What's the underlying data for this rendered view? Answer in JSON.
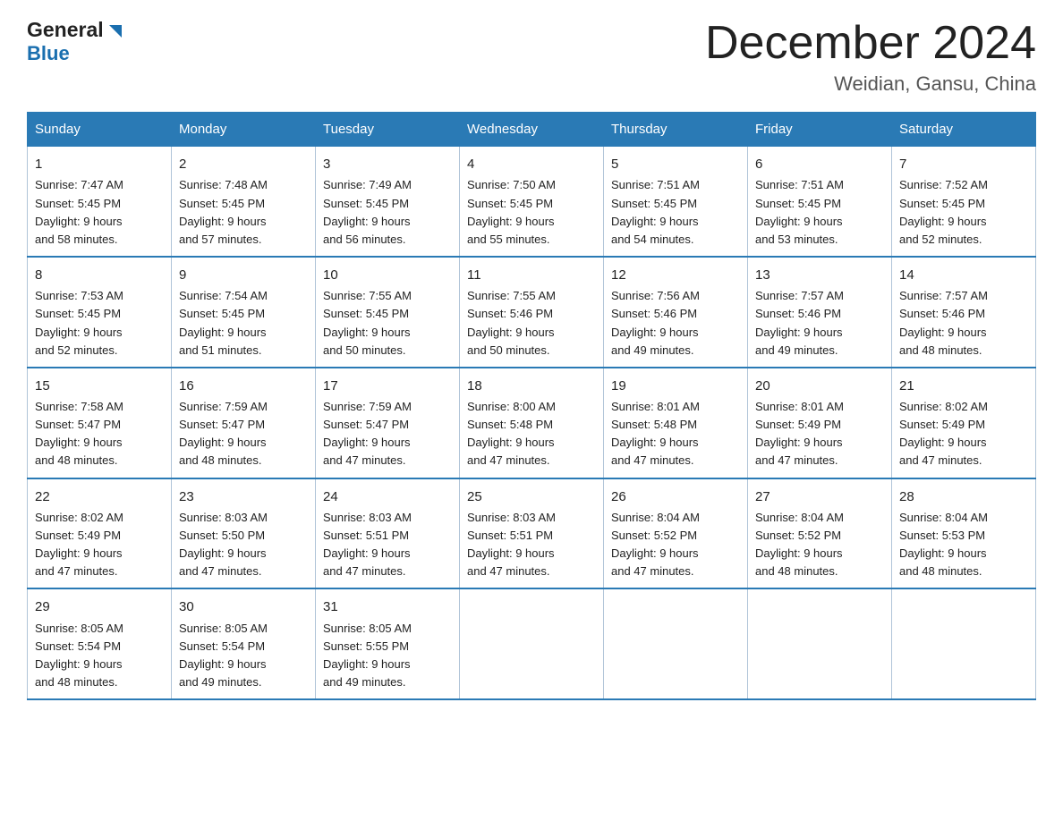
{
  "header": {
    "logo_general": "General",
    "logo_blue": "Blue",
    "title": "December 2024",
    "subtitle": "Weidian, Gansu, China"
  },
  "days_of_week": [
    "Sunday",
    "Monday",
    "Tuesday",
    "Wednesday",
    "Thursday",
    "Friday",
    "Saturday"
  ],
  "weeks": [
    [
      {
        "day": "1",
        "sunrise": "7:47 AM",
        "sunset": "5:45 PM",
        "daylight": "9 hours and 58 minutes."
      },
      {
        "day": "2",
        "sunrise": "7:48 AM",
        "sunset": "5:45 PM",
        "daylight": "9 hours and 57 minutes."
      },
      {
        "day": "3",
        "sunrise": "7:49 AM",
        "sunset": "5:45 PM",
        "daylight": "9 hours and 56 minutes."
      },
      {
        "day": "4",
        "sunrise": "7:50 AM",
        "sunset": "5:45 PM",
        "daylight": "9 hours and 55 minutes."
      },
      {
        "day": "5",
        "sunrise": "7:51 AM",
        "sunset": "5:45 PM",
        "daylight": "9 hours and 54 minutes."
      },
      {
        "day": "6",
        "sunrise": "7:51 AM",
        "sunset": "5:45 PM",
        "daylight": "9 hours and 53 minutes."
      },
      {
        "day": "7",
        "sunrise": "7:52 AM",
        "sunset": "5:45 PM",
        "daylight": "9 hours and 52 minutes."
      }
    ],
    [
      {
        "day": "8",
        "sunrise": "7:53 AM",
        "sunset": "5:45 PM",
        "daylight": "9 hours and 52 minutes."
      },
      {
        "day": "9",
        "sunrise": "7:54 AM",
        "sunset": "5:45 PM",
        "daylight": "9 hours and 51 minutes."
      },
      {
        "day": "10",
        "sunrise": "7:55 AM",
        "sunset": "5:45 PM",
        "daylight": "9 hours and 50 minutes."
      },
      {
        "day": "11",
        "sunrise": "7:55 AM",
        "sunset": "5:46 PM",
        "daylight": "9 hours and 50 minutes."
      },
      {
        "day": "12",
        "sunrise": "7:56 AM",
        "sunset": "5:46 PM",
        "daylight": "9 hours and 49 minutes."
      },
      {
        "day": "13",
        "sunrise": "7:57 AM",
        "sunset": "5:46 PM",
        "daylight": "9 hours and 49 minutes."
      },
      {
        "day": "14",
        "sunrise": "7:57 AM",
        "sunset": "5:46 PM",
        "daylight": "9 hours and 48 minutes."
      }
    ],
    [
      {
        "day": "15",
        "sunrise": "7:58 AM",
        "sunset": "5:47 PM",
        "daylight": "9 hours and 48 minutes."
      },
      {
        "day": "16",
        "sunrise": "7:59 AM",
        "sunset": "5:47 PM",
        "daylight": "9 hours and 48 minutes."
      },
      {
        "day": "17",
        "sunrise": "7:59 AM",
        "sunset": "5:47 PM",
        "daylight": "9 hours and 47 minutes."
      },
      {
        "day": "18",
        "sunrise": "8:00 AM",
        "sunset": "5:48 PM",
        "daylight": "9 hours and 47 minutes."
      },
      {
        "day": "19",
        "sunrise": "8:01 AM",
        "sunset": "5:48 PM",
        "daylight": "9 hours and 47 minutes."
      },
      {
        "day": "20",
        "sunrise": "8:01 AM",
        "sunset": "5:49 PM",
        "daylight": "9 hours and 47 minutes."
      },
      {
        "day": "21",
        "sunrise": "8:02 AM",
        "sunset": "5:49 PM",
        "daylight": "9 hours and 47 minutes."
      }
    ],
    [
      {
        "day": "22",
        "sunrise": "8:02 AM",
        "sunset": "5:49 PM",
        "daylight": "9 hours and 47 minutes."
      },
      {
        "day": "23",
        "sunrise": "8:03 AM",
        "sunset": "5:50 PM",
        "daylight": "9 hours and 47 minutes."
      },
      {
        "day": "24",
        "sunrise": "8:03 AM",
        "sunset": "5:51 PM",
        "daylight": "9 hours and 47 minutes."
      },
      {
        "day": "25",
        "sunrise": "8:03 AM",
        "sunset": "5:51 PM",
        "daylight": "9 hours and 47 minutes."
      },
      {
        "day": "26",
        "sunrise": "8:04 AM",
        "sunset": "5:52 PM",
        "daylight": "9 hours and 47 minutes."
      },
      {
        "day": "27",
        "sunrise": "8:04 AM",
        "sunset": "5:52 PM",
        "daylight": "9 hours and 48 minutes."
      },
      {
        "day": "28",
        "sunrise": "8:04 AM",
        "sunset": "5:53 PM",
        "daylight": "9 hours and 48 minutes."
      }
    ],
    [
      {
        "day": "29",
        "sunrise": "8:05 AM",
        "sunset": "5:54 PM",
        "daylight": "9 hours and 48 minutes."
      },
      {
        "day": "30",
        "sunrise": "8:05 AM",
        "sunset": "5:54 PM",
        "daylight": "9 hours and 49 minutes."
      },
      {
        "day": "31",
        "sunrise": "8:05 AM",
        "sunset": "5:55 PM",
        "daylight": "9 hours and 49 minutes."
      },
      null,
      null,
      null,
      null
    ]
  ],
  "cell_labels": {
    "sunrise": "Sunrise:",
    "sunset": "Sunset:",
    "daylight": "Daylight:"
  }
}
